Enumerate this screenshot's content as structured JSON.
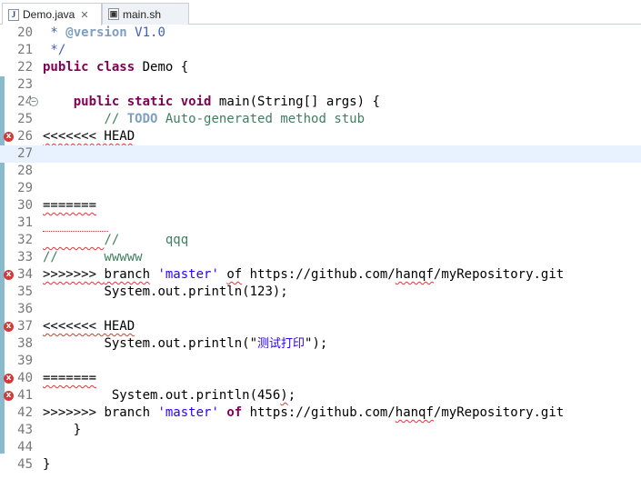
{
  "tabs": [
    {
      "label": "Demo.java",
      "icon": "java-file-icon",
      "icon_glyph": "J",
      "close": "✕"
    },
    {
      "label": "main.sh",
      "icon": "shell-file-icon",
      "icon_glyph": "▣"
    }
  ],
  "lines": {
    "l20": {
      "num": "20",
      "p1": " * ",
      "p2": "@version",
      "p3": " V1.0"
    },
    "l21": {
      "num": "21",
      "p1": " */"
    },
    "l22": {
      "num": "22",
      "kw1": "public",
      "kw2": "class",
      "p1": " Demo {"
    },
    "l23": {
      "num": "23"
    },
    "l24": {
      "num": "24",
      "indent": "    ",
      "kw1": "public",
      "kw2": "static",
      "kw3": "void",
      "p1": " main(String[] args) {",
      "fold": "−"
    },
    "l25": {
      "num": "25",
      "indent": "        ",
      "p1": "// ",
      "p2": "TODO",
      "p3": " Auto-generated method stub"
    },
    "l26": {
      "num": "26",
      "p1": "<<<<<<< HEAD"
    },
    "l27": {
      "num": "27"
    },
    "l28": {
      "num": "28"
    },
    "l29": {
      "num": "29"
    },
    "l30": {
      "num": "30",
      "p1": "======="
    },
    "l31": {
      "num": "31"
    },
    "l32": {
      "num": "32",
      "indent": "        ",
      "p1": "//      qqq"
    },
    "l33": {
      "num": "33",
      "p1": "//      wwwww"
    },
    "l34": {
      "num": "34",
      "p1": ">>>>>>> ",
      "p2": "branch",
      "p3": " ",
      "p4": "'master'",
      "p5": " ",
      "p6": "of",
      "p7": " https://github.com/",
      "p8": "hanqf",
      "p9": "/myRepository.git"
    },
    "l35": {
      "num": "35",
      "indent": "        ",
      "p1": "System.out.println(123);"
    },
    "l36": {
      "num": "36"
    },
    "l37": {
      "num": "37",
      "p1": "<<<<<<< HEAD"
    },
    "l38": {
      "num": "38",
      "indent": "        ",
      "p1": "System.out.println(\"",
      "p2": "测试打印",
      "p3": "\");"
    },
    "l39": {
      "num": "39"
    },
    "l40": {
      "num": "40",
      "p1": "======="
    },
    "l41": {
      "num": "41",
      "indent": "         ",
      "p1": "System.out.println(456",
      "p2": ")",
      "p3": ";"
    },
    "l42": {
      "num": "42",
      "p1": ">>>>>>> ",
      "p2": "branch",
      "p3": " ",
      "p4": "'master'",
      "p5": " ",
      "p6": "of",
      "p7": " https://github.com/",
      "p8": "hanqf",
      "p9": "/myRepository.git"
    },
    "l43": {
      "num": "43",
      "indent": "    ",
      "p1": "}"
    },
    "l44": {
      "num": "44"
    },
    "l45": {
      "num": "45",
      "p1": "}"
    }
  },
  "error_glyph": "x",
  "colors": {
    "keyword": "#7f0055",
    "javadoc": "#3f5fbf",
    "comment": "#3f7f5f",
    "string": "#2a00ff",
    "error": "#d43a35",
    "current_line": "#e8f2fe"
  }
}
